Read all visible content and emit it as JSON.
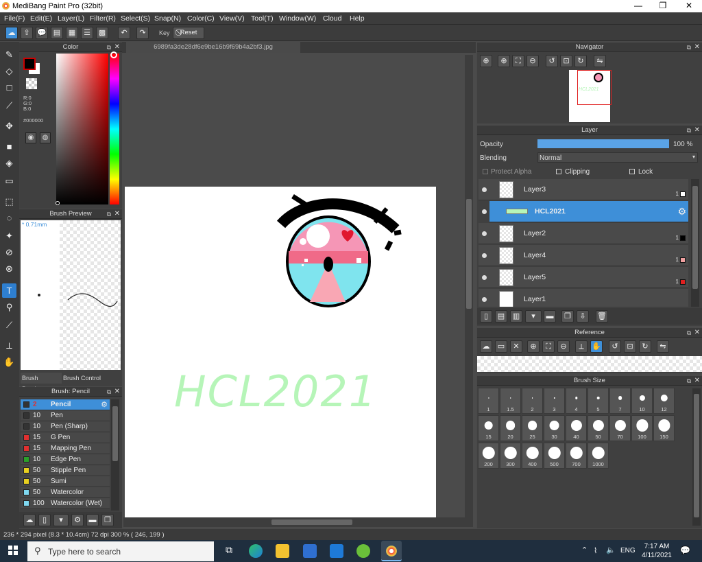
{
  "titlebar": {
    "title": "MediBang Paint Pro (32bit)",
    "minimize": "—",
    "maximize": "❐",
    "close": "✕"
  },
  "menu": [
    "File(F)",
    "Edit(E)",
    "Layer(L)",
    "Filter(R)",
    "Select(S)",
    "Snap(N)",
    "Color(C)",
    "View(V)",
    "Tool(T)",
    "Window(W)",
    "Cloud",
    "Help"
  ],
  "toolbar": {
    "key_label": "Key",
    "reset_label": "Reset"
  },
  "color_panel": {
    "title": "Color",
    "r": "R:0",
    "g": "G:0",
    "b": "B:0",
    "hex": "#000000",
    "fg_color": "#000000"
  },
  "brush_preview": {
    "title": "Brush Preview",
    "size_label": "* 0.71mm",
    "tab_preview": "Brush Preview",
    "tab_control": "Brush Control"
  },
  "brush_list": {
    "title": "Brush: Pencil",
    "items": [
      {
        "size": "2",
        "name": "Pencil",
        "color": "#333333"
      },
      {
        "size": "10",
        "name": "Pen",
        "color": "#333333"
      },
      {
        "size": "10",
        "name": "Pen (Sharp)",
        "color": "#333333"
      },
      {
        "size": "15",
        "name": "G Pen",
        "color": "#e03030"
      },
      {
        "size": "15",
        "name": "Mapping Pen",
        "color": "#e03030"
      },
      {
        "size": "10",
        "name": "Edge Pen",
        "color": "#2aa02a"
      },
      {
        "size": "50",
        "name": "Stipple Pen",
        "color": "#e8d020"
      },
      {
        "size": "50",
        "name": "Sumi",
        "color": "#e8d020"
      },
      {
        "size": "50",
        "name": "Watercolor",
        "color": "#7fd8f0"
      },
      {
        "size": "100",
        "name": "Watercolor (Wet)",
        "color": "#7fd8f0"
      }
    ]
  },
  "canvas": {
    "filename": "6989fa3de28df6e9be16b9f69b4a2bf3.jpg",
    "artwork_text": "HCL2021"
  },
  "navigator": {
    "title": "Navigator"
  },
  "layer_panel": {
    "title": "Layer",
    "opacity_label": "Opacity",
    "opacity_value": "100 %",
    "opacity_fraction": 1.0,
    "blending_label": "Blending",
    "blending_value": "Normal",
    "protect_alpha": "Protect Alpha",
    "clipping": "Clipping",
    "lock": "Lock",
    "layers": [
      {
        "name": "Layer3",
        "num": "1",
        "color": "#ffffff",
        "selected": false
      },
      {
        "name": "HCL2021",
        "num": "",
        "color": "",
        "selected": true
      },
      {
        "name": "Layer2",
        "num": "1",
        "color": "#000000",
        "selected": false
      },
      {
        "name": "Layer4",
        "num": "1",
        "color": "#f0a0a0",
        "selected": false
      },
      {
        "name": "Layer5",
        "num": "1",
        "color": "#e02020",
        "selected": false
      },
      {
        "name": "Layer1",
        "num": "",
        "color": "",
        "selected": false
      }
    ]
  },
  "reference": {
    "title": "Reference"
  },
  "brush_size": {
    "title": "Brush Size",
    "sizes": [
      "1",
      "1.5",
      "2",
      "3",
      "4",
      "5",
      "7",
      "10",
      "12",
      "15",
      "20",
      "25",
      "30",
      "40",
      "50",
      "70",
      "100",
      "150",
      "200",
      "300",
      "400",
      "500",
      "700",
      "1000"
    ]
  },
  "status": {
    "text": "236 * 294 pixel  (8.3 * 10.4cm)  72 dpi  300 %  ( 246, 199 )"
  },
  "taskbar": {
    "search_placeholder": "Type here to search",
    "time": "7:17 AM",
    "date": "4/11/2021",
    "lang": "ENG"
  }
}
